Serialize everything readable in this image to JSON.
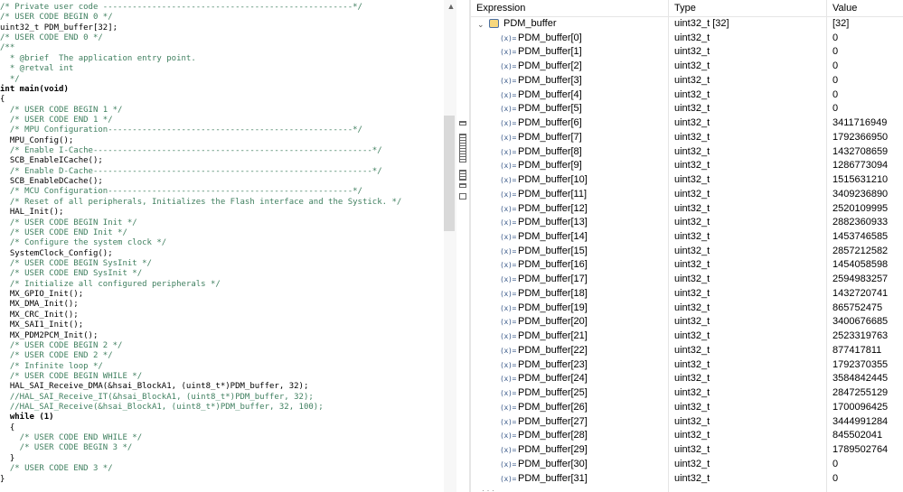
{
  "editor": {
    "lines": [
      {
        "text": "/* Private user code ---------------------------------------------------*/",
        "style": "comment"
      },
      {
        "text": "/* USER CODE BEGIN 0 */",
        "style": "comment"
      },
      {
        "text": "uint32_t PDM_buffer[32];",
        "style": "code"
      },
      {
        "text": "/* USER CODE END 0 */",
        "style": "comment"
      },
      {
        "text": "/**",
        "style": "comment"
      },
      {
        "text": "  * @brief  The application entry point.",
        "style": "comment"
      },
      {
        "text": "  * @retval int",
        "style": "comment"
      },
      {
        "text": "  */",
        "style": "comment"
      },
      {
        "text": "int main(void)",
        "style": "main"
      },
      {
        "text": "{",
        "style": "code"
      },
      {
        "text": "  /* USER CODE BEGIN 1 */",
        "style": "comment"
      },
      {
        "text": "  /* USER CODE END 1 */",
        "style": "comment"
      },
      {
        "text": "  /* MPU Configuration--------------------------------------------------*/",
        "style": "comment"
      },
      {
        "text": "  MPU_Config();",
        "style": "code"
      },
      {
        "text": "  /* Enable I-Cache---------------------------------------------------------*/",
        "style": "comment"
      },
      {
        "text": "  SCB_EnableICache();",
        "style": "code"
      },
      {
        "text": "  /* Enable D-Cache---------------------------------------------------------*/",
        "style": "comment"
      },
      {
        "text": "  SCB_EnableDCache();",
        "style": "code"
      },
      {
        "text": "  /* MCU Configuration--------------------------------------------------*/",
        "style": "comment"
      },
      {
        "text": "  /* Reset of all peripherals, Initializes the Flash interface and the Systick. */",
        "style": "comment"
      },
      {
        "text": "  HAL_Init();",
        "style": "code"
      },
      {
        "text": "  /* USER CODE BEGIN Init */",
        "style": "comment"
      },
      {
        "text": "  /* USER CODE END Init */",
        "style": "comment"
      },
      {
        "text": "  /* Configure the system clock */",
        "style": "comment"
      },
      {
        "text": "  SystemClock_Config();",
        "style": "code"
      },
      {
        "text": "  /* USER CODE BEGIN SysInit */",
        "style": "comment"
      },
      {
        "text": "  /* USER CODE END SysInit */",
        "style": "comment"
      },
      {
        "text": "  /* Initialize all configured peripherals */",
        "style": "comment"
      },
      {
        "text": "  MX_GPIO_Init();",
        "style": "code"
      },
      {
        "text": "  MX_DMA_Init();",
        "style": "code"
      },
      {
        "text": "  MX_CRC_Init();",
        "style": "code"
      },
      {
        "text": "  MX_SAI1_Init();",
        "style": "code"
      },
      {
        "text": "  MX_PDM2PCM_Init();",
        "style": "code"
      },
      {
        "text": "  /* USER CODE BEGIN 2 */",
        "style": "comment"
      },
      {
        "text": "  /* USER CODE END 2 */",
        "style": "comment"
      },
      {
        "text": "  /* Infinite loop */",
        "style": "comment"
      },
      {
        "text": "  /* USER CODE BEGIN WHILE */",
        "style": "comment"
      },
      {
        "text": "  HAL_SAI_Receive_DMA(&hsai_BlockA1, (uint8_t*)PDM_buffer, 32);",
        "style": "code"
      },
      {
        "text": "  //HAL_SAI_Receive_IT(&hsai_BlockA1, (uint8_t*)PDM_buffer, 32);",
        "style": "comment"
      },
      {
        "text": "  //HAL_SAI_Receive(&hsai_BlockA1, (uint8_t*)PDM_buffer, 32, 100);",
        "style": "comment"
      },
      {
        "text": "  while (1)",
        "style": "while"
      },
      {
        "text": "  {",
        "style": "code"
      },
      {
        "text": "    /* USER CODE END WHILE */",
        "style": "comment"
      },
      {
        "text": "    /* USER CODE BEGIN 3 */",
        "style": "comment"
      },
      {
        "text": "  }",
        "style": "code"
      },
      {
        "text": "  /* USER CODE END 3 */",
        "style": "comment"
      },
      {
        "text": "}",
        "style": "code"
      }
    ]
  },
  "variables": {
    "headers": {
      "expression": "Expression",
      "type": "Type",
      "value": "Value"
    },
    "root": {
      "name": "PDM_buffer",
      "type": "uint32_t [32]",
      "value": "[32]",
      "icon": "array-variable-icon",
      "expanded": true
    },
    "child_icon_label": "(x)=",
    "children": [
      {
        "name": "PDM_buffer[0]",
        "type": "uint32_t",
        "value": "0"
      },
      {
        "name": "PDM_buffer[1]",
        "type": "uint32_t",
        "value": "0"
      },
      {
        "name": "PDM_buffer[2]",
        "type": "uint32_t",
        "value": "0"
      },
      {
        "name": "PDM_buffer[3]",
        "type": "uint32_t",
        "value": "0"
      },
      {
        "name": "PDM_buffer[4]",
        "type": "uint32_t",
        "value": "0"
      },
      {
        "name": "PDM_buffer[5]",
        "type": "uint32_t",
        "value": "0"
      },
      {
        "name": "PDM_buffer[6]",
        "type": "uint32_t",
        "value": "3411716949"
      },
      {
        "name": "PDM_buffer[7]",
        "type": "uint32_t",
        "value": "1792366950"
      },
      {
        "name": "PDM_buffer[8]",
        "type": "uint32_t",
        "value": "1432708659"
      },
      {
        "name": "PDM_buffer[9]",
        "type": "uint32_t",
        "value": "1286773094"
      },
      {
        "name": "PDM_buffer[10]",
        "type": "uint32_t",
        "value": "1515631210"
      },
      {
        "name": "PDM_buffer[11]",
        "type": "uint32_t",
        "value": "3409236890"
      },
      {
        "name": "PDM_buffer[12]",
        "type": "uint32_t",
        "value": "2520109995"
      },
      {
        "name": "PDM_buffer[13]",
        "type": "uint32_t",
        "value": "2882360933"
      },
      {
        "name": "PDM_buffer[14]",
        "type": "uint32_t",
        "value": "1453746585"
      },
      {
        "name": "PDM_buffer[15]",
        "type": "uint32_t",
        "value": "2857212582"
      },
      {
        "name": "PDM_buffer[16]",
        "type": "uint32_t",
        "value": "1454058598"
      },
      {
        "name": "PDM_buffer[17]",
        "type": "uint32_t",
        "value": "2594983257"
      },
      {
        "name": "PDM_buffer[18]",
        "type": "uint32_t",
        "value": "1432720741"
      },
      {
        "name": "PDM_buffer[19]",
        "type": "uint32_t",
        "value": "865752475"
      },
      {
        "name": "PDM_buffer[20]",
        "type": "uint32_t",
        "value": "3400676685"
      },
      {
        "name": "PDM_buffer[21]",
        "type": "uint32_t",
        "value": "2523319763"
      },
      {
        "name": "PDM_buffer[22]",
        "type": "uint32_t",
        "value": "877417811"
      },
      {
        "name": "PDM_buffer[23]",
        "type": "uint32_t",
        "value": "1792370355"
      },
      {
        "name": "PDM_buffer[24]",
        "type": "uint32_t",
        "value": "3584842445"
      },
      {
        "name": "PDM_buffer[25]",
        "type": "uint32_t",
        "value": "2847255129"
      },
      {
        "name": "PDM_buffer[26]",
        "type": "uint32_t",
        "value": "1700096425"
      },
      {
        "name": "PDM_buffer[27]",
        "type": "uint32_t",
        "value": "3444991284"
      },
      {
        "name": "PDM_buffer[28]",
        "type": "uint32_t",
        "value": "845502041"
      },
      {
        "name": "PDM_buffer[29]",
        "type": "uint32_t",
        "value": "1789502764"
      },
      {
        "name": "PDM_buffer[30]",
        "type": "uint32_t",
        "value": "0"
      },
      {
        "name": "PDM_buffer[31]",
        "type": "uint32_t",
        "value": "0"
      }
    ]
  },
  "colors": {
    "comment": "#3f7f5f",
    "keyword": "#7f0055",
    "icon_blue": "#3a5a8a"
  }
}
